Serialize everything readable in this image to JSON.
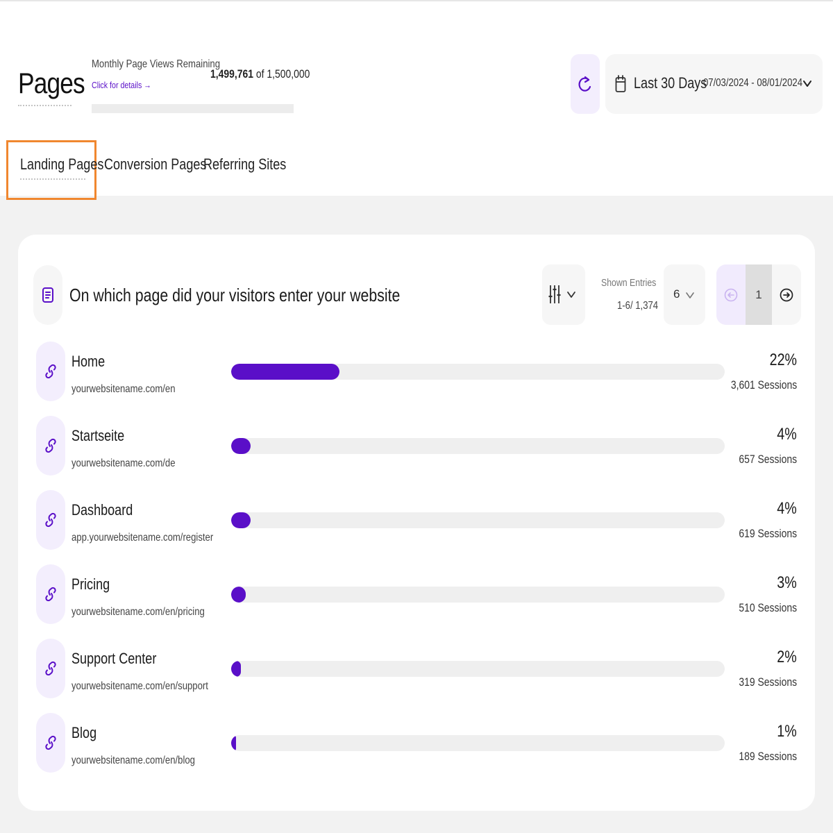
{
  "header": {
    "title": "Pages",
    "views": {
      "label": "Monthly Page Views Remaining",
      "link": "Click for details →",
      "used": "1,499,761",
      "of_text": " of ",
      "total": "1,500,000",
      "remaining_fraction": 0.0
    },
    "date_picker": {
      "range_label": "Last 30 Days",
      "range_value": "07/03/2024 - 08/01/2024"
    }
  },
  "tabs": [
    {
      "label": "Landing Pages",
      "active": true
    },
    {
      "label": "Conversion Pages",
      "active": false
    },
    {
      "label": "Referring Sites",
      "active": false
    }
  ],
  "card": {
    "title": "On which page did your visitors enter your website",
    "shown_entries_label": "Shown Entries",
    "shown_entries_value": "1-6/ 1,374",
    "entries_per_page": "6",
    "current_page": "1"
  },
  "rows": [
    {
      "name": "Home",
      "url": "yourwebsitename.com/en",
      "percent": "22%",
      "sessions": "3,601 Sessions",
      "fraction": 0.22
    },
    {
      "name": "Startseite",
      "url": "yourwebsitename.com/de",
      "percent": "4%",
      "sessions": "657 Sessions",
      "fraction": 0.04
    },
    {
      "name": "Dashboard",
      "url": "app.yourwebsitename.com/register",
      "percent": "4%",
      "sessions": "619 Sessions",
      "fraction": 0.04
    },
    {
      "name": "Pricing",
      "url": "yourwebsitename.com/en/pricing",
      "percent": "3%",
      "sessions": "510 Sessions",
      "fraction": 0.03
    },
    {
      "name": "Support Center",
      "url": "yourwebsitename.com/en/support",
      "percent": "2%",
      "sessions": "319 Sessions",
      "fraction": 0.02
    },
    {
      "name": "Blog",
      "url": "yourwebsitename.com/en/blog",
      "percent": "1%",
      "sessions": "189 Sessions",
      "fraction": 0.01
    }
  ],
  "colors": {
    "accent": "#5a0fc8",
    "accent_light": "#f3eefd",
    "highlight": "#f0872f",
    "track": "#efefef"
  },
  "icons": {
    "refresh": "refresh-icon",
    "calendar": "calendar-icon",
    "chevron": "chevron-down-icon",
    "card": "document-icon",
    "filter": "sliders-icon",
    "prev": "arrow-left-circle-icon",
    "next": "arrow-right-circle-icon",
    "row": "link-icon"
  }
}
